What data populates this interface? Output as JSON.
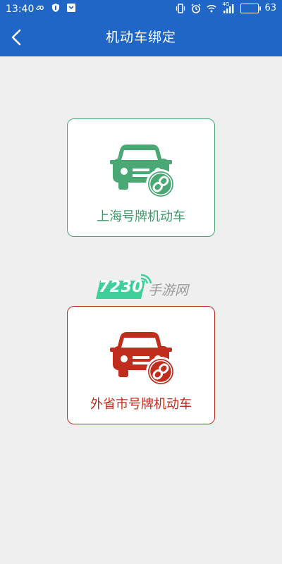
{
  "status_bar": {
    "time": "13:40",
    "battery": "63",
    "network_label": "4G",
    "icons_left": [
      "infinity-icon",
      "shield-icon",
      "download-icon"
    ],
    "icons_right": [
      "vibrate-icon",
      "alarm-icon",
      "wifi-icon",
      "signal-icon",
      "battery-icon"
    ]
  },
  "nav": {
    "title": "机动车绑定",
    "back_icon": "chevron-left-icon"
  },
  "cards": [
    {
      "label": "上海号牌机动车",
      "color": "#3c9a69",
      "icon": "car-link-icon"
    },
    {
      "label": "外省市号牌机动车",
      "color": "#c02d1c",
      "icon": "car-link-icon"
    }
  ],
  "watermark": {
    "number": "7230",
    "text": "手游网",
    "color": "#3fcf9a"
  },
  "colors": {
    "header": "#1f66c7",
    "background": "#efefef"
  }
}
